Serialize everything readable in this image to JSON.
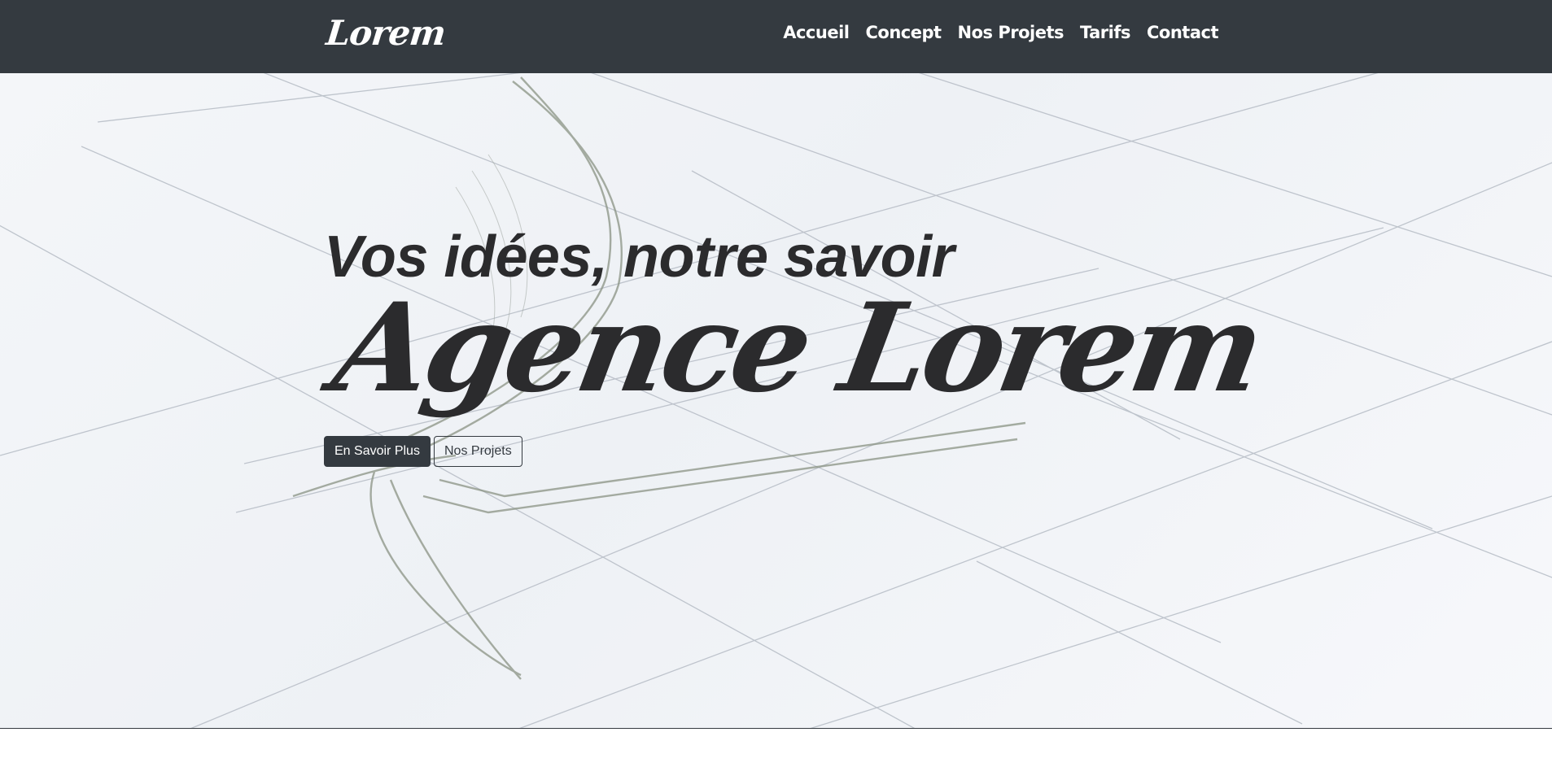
{
  "navbar": {
    "brand": "Lorem",
    "links": [
      "Accueil",
      "Concept",
      "Nos Projets",
      "Tarifs",
      "Contact"
    ]
  },
  "hero": {
    "subtitle": "Vos idées, notre savoir",
    "title": "Agence Lorem",
    "primary_button": "En Savoir Plus",
    "secondary_button": "Nos Projets"
  },
  "colors": {
    "navbar_bg": "#343a40",
    "text_dark": "#2b2b2d",
    "sketch_lines": "#8a9384"
  }
}
